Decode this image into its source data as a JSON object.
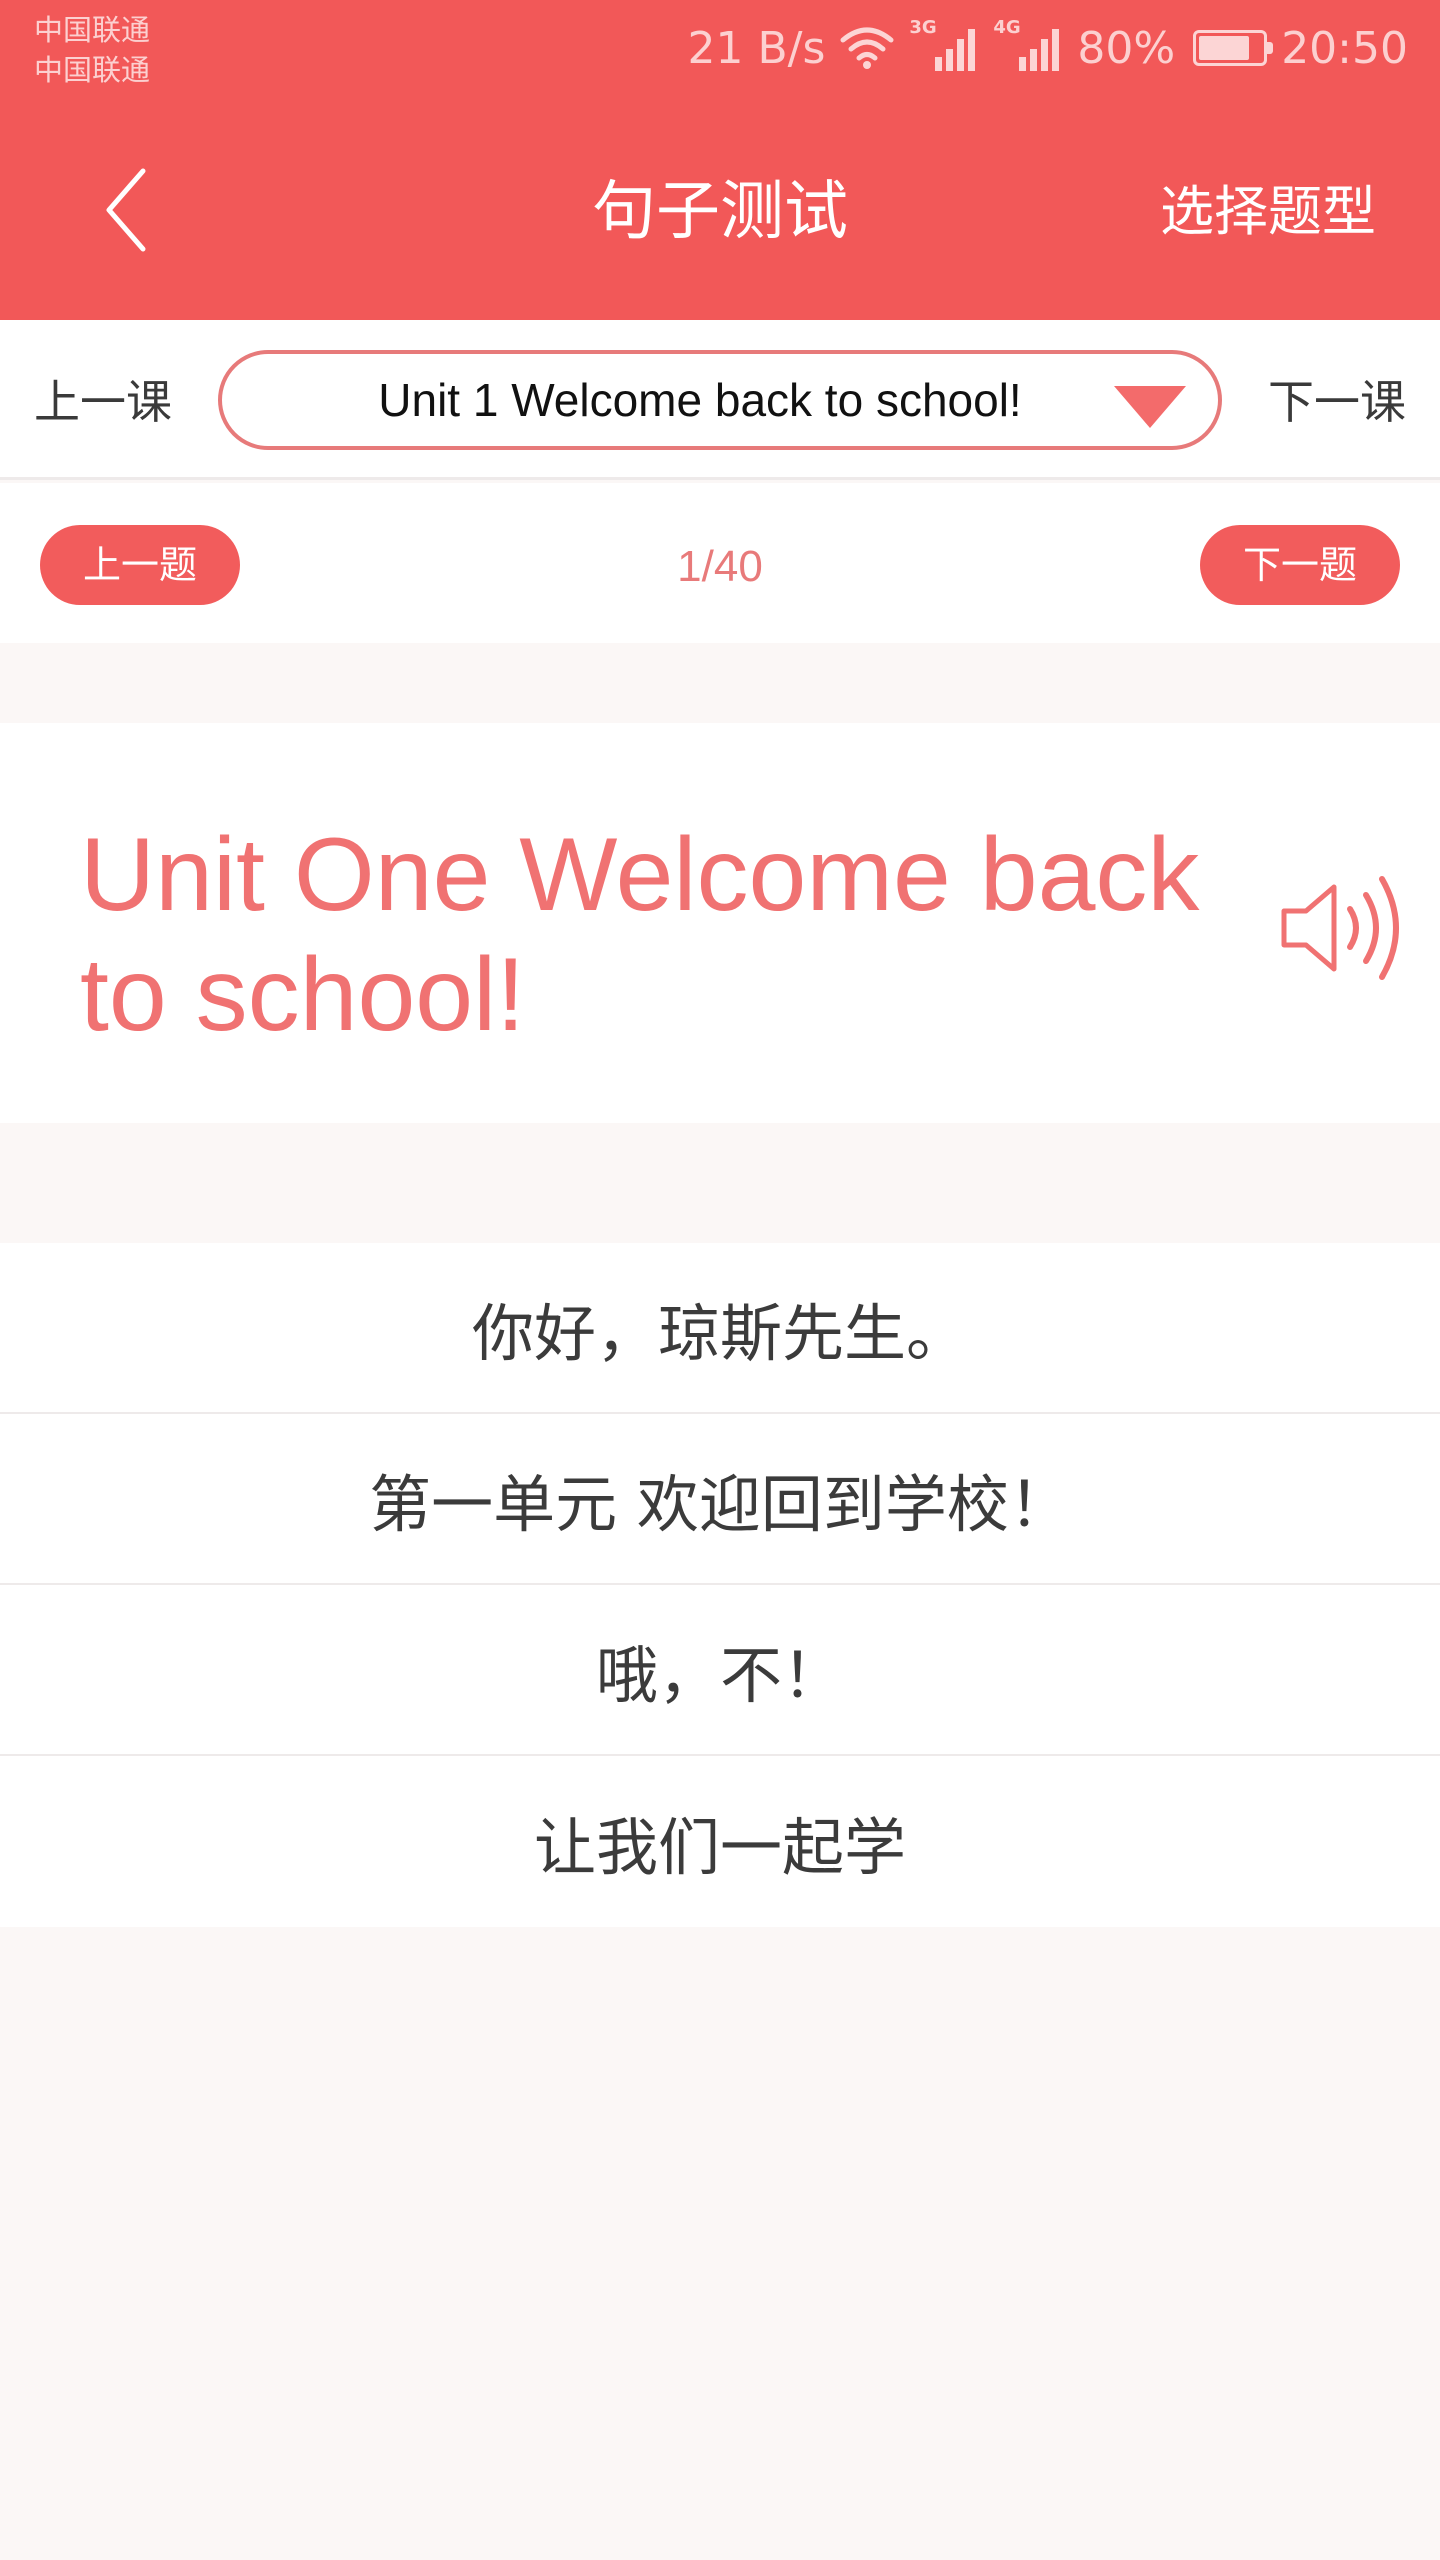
{
  "status_bar": {
    "carrier_1": "中国联通",
    "carrier_2": "中国联通",
    "net_speed": "21 B/s",
    "sig_3g": "3G",
    "sig_4g": "4G",
    "battery": "80%",
    "battery_level": 0.8,
    "time": "20:50"
  },
  "header": {
    "title": "句子测试",
    "right_action": "选择题型"
  },
  "lesson_bar": {
    "prev": "上一课",
    "current": "Unit 1 Welcome back to school!",
    "next": "下一课"
  },
  "question_nav": {
    "prev": "上一题",
    "counter": "1/40",
    "next": "下一题"
  },
  "question": {
    "text": "Unit One Welcome back to school!"
  },
  "options": [
    "你好，琼斯先生。",
    "第一单元 欢迎回到学校！",
    "哦，不！",
    "让我们一起学"
  ],
  "colors": {
    "accent": "#f25858",
    "question_text": "#f07272",
    "background": "#fbf7f6"
  }
}
